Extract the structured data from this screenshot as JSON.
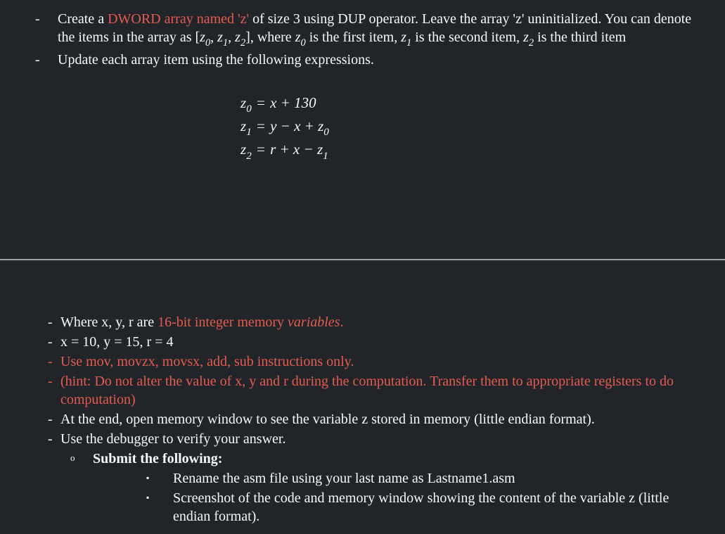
{
  "topSection": {
    "item1": {
      "prefix": "Create a ",
      "red": "DWORD array named 'z'",
      "suffix": " of size 3 using DUP operator. Leave the array 'z' uninitialized. You can denote the items in the array as [",
      "arr": {
        "z0": "z",
        "z0sub": "0",
        "z1": "z",
        "z1sub": "1",
        "z2": "z",
        "z2sub": "2"
      },
      "afterArr": "], where ",
      "z0desc": " is the first item, ",
      "z1desc": " is the second item, ",
      "z2desc": " is the third item"
    },
    "item2": "Update each array item using the following expressions.",
    "equations": {
      "eq1": {
        "lhs_var": "z",
        "lhs_sub": "0",
        "eq": " = ",
        "rhs": "x + 130"
      },
      "eq2": {
        "lhs_var": "z",
        "lhs_sub": "1",
        "eq": " = ",
        "rhs1": "y − x + ",
        "rhs_var": "z",
        "rhs_sub": "0"
      },
      "eq3": {
        "lhs_var": "z",
        "lhs_sub": "2",
        "eq": " = ",
        "rhs1": "r + x − ",
        "rhs_var": "z",
        "rhs_sub": "1"
      }
    }
  },
  "bottomSection": {
    "b1": {
      "prefix": "Where x, y, r are ",
      "red": "16-bit integer memory ",
      "redItalic": "variables",
      "period": "."
    },
    "b2": "x = 10, y = 15, r = 4",
    "b3": "Use mov, movzx, movsx, add, sub instructions only.",
    "b4": "(hint: Do not alter the value of x, y and r during the computation. Transfer them to appropriate registers to do computation)",
    "b5": "At the end, open memory window to see the variable z stored in memory (little endian format).",
    "b6": "Use the debugger to verify your answer.",
    "submit": "Submit the following:",
    "s1": "Rename the asm file using your last name  as Lastname1.asm",
    "s2": "Screenshot of the code and memory window showing the content of the variable z (little endian format)."
  }
}
